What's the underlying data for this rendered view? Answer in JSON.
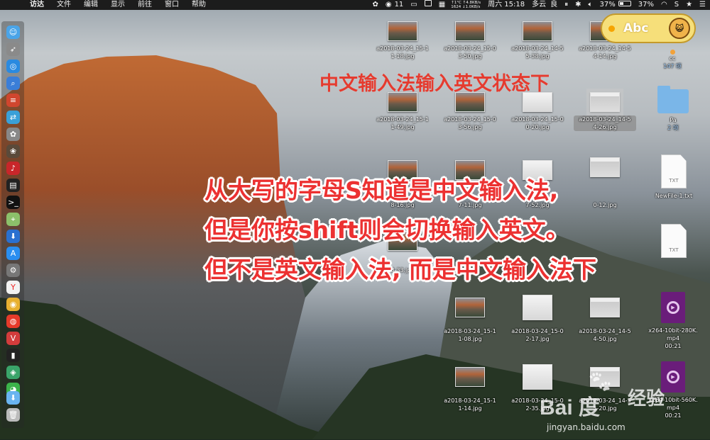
{
  "menubar": {
    "app_name": "访达",
    "items": [
      "文件",
      "编辑",
      "显示",
      "前往",
      "窗口",
      "帮助"
    ],
    "status": {
      "notif_count": "11",
      "net_up": "↑1°C ↑4.8KB/s",
      "net_down": "1624 ↓1.0KB/s",
      "clock": "周六 15:18",
      "weather": "多云",
      "air": "良",
      "battery_a": "37%",
      "battery_b": "37%"
    }
  },
  "ime_badge": {
    "text": "Abc"
  },
  "annotations": {
    "title": "中文输入法输入英文状态下",
    "line1": "从大写的字母S知道是中文输入法,",
    "line2": "但是你按shift则会切换输入英文。",
    "line3": "但不是英文输入法, 而是中文输入法下"
  },
  "desktop_files": [
    {
      "name": "a2018-03-24_15-1\n1-18.jpg",
      "kind": "photo"
    },
    {
      "name": "a2018-03-24_15-0\n3-50.jpg",
      "kind": "photo"
    },
    {
      "name": "a2018-03-24_14-5\n5-38.jpg",
      "kind": "photo"
    },
    {
      "name": "a2018-03-24_14-5\n4-14.jpg",
      "kind": "photo"
    },
    {
      "name": "a2018-03-24_15-1\n1-49.jpg",
      "kind": "photo"
    },
    {
      "name": "a2018-03-24_15-0\n3-56.jpg",
      "kind": "photo"
    },
    {
      "name": "a2018-03-24_15-0\n0-20.jpg",
      "kind": "light"
    },
    {
      "name": "a2018-03-24_14-5\n4-26.jpg",
      "kind": "win"
    },
    {
      "name": "8-16.jpg",
      "kind": "photo"
    },
    {
      "name": "7-11.jpg",
      "kind": "photo"
    },
    {
      "name": "7-52.jpg",
      "kind": "light"
    },
    {
      "name": "0-12.jpg",
      "kind": "win"
    },
    {
      "name": "8-33.jpg",
      "kind": "photo"
    },
    {
      "name": "a2018-03-24_15-1\n1-08.jpg",
      "kind": "photo"
    },
    {
      "name": "a2018-03-24_15-0\n2-17.jpg",
      "kind": "light"
    },
    {
      "name": "a2018-03-24_14-5\n4-50.jpg",
      "kind": "win"
    },
    {
      "name": "a2018-03-24_15-1\n1-14.jpg",
      "kind": "photo"
    },
    {
      "name": "a2018-03-24_15-0\n2-35.jpg",
      "kind": "light"
    },
    {
      "name": "a2018-03-24_14-5\n5-20.jpg",
      "kind": "win"
    }
  ],
  "side_items": {
    "cc_name": "cc",
    "cc_count": "147 项",
    "pa_name": "Pa",
    "pa_count": "2 项",
    "txt1_name": "NewFile-1.txt",
    "txt_badge": "TXT",
    "video1_name": "x264-10bit-280K.\nmp4",
    "video1_dur": "00:21",
    "video2_name": "x264-10bit-560K.\nmp4",
    "video2_dur": "00:21"
  },
  "watermark": {
    "brand": "Bai 度",
    "jingyan": "经验",
    "url": "jingyan.baidu.com"
  },
  "colors": {
    "annotation_red": "#ec3131",
    "menubar_bg": "#1c1c1c",
    "ime_yellow": "#f6df7a"
  }
}
